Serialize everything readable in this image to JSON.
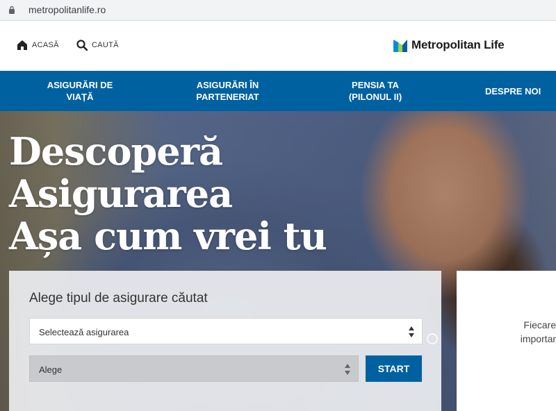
{
  "browser": {
    "url": "metropolitanlife.ro"
  },
  "utility": {
    "home_label": "ACASĂ",
    "search_label": "CAUTĂ",
    "logo_text": "Metropolitan Life",
    "logo_colors": [
      "#0090da",
      "#a4ce4e",
      "#0061a0"
    ]
  },
  "nav": {
    "items": [
      {
        "line1": "ASIGURĂRI DE",
        "line2": "VIAȚĂ"
      },
      {
        "line1": "ASIGURĂRI ÎN",
        "line2": "PARTENERIAT"
      },
      {
        "line1": "PENSIA TA",
        "line2": "(PILONUL II)"
      },
      {
        "line1": "DESPRE NOI",
        "line2": ""
      }
    ],
    "background": "#0061a0"
  },
  "hero": {
    "headline_line1": "Descoperă",
    "headline_line2": "Asigurarea",
    "headline_line3": "Așa cum vrei tu"
  },
  "selector": {
    "title": "Alege tipul de asigurare căutat",
    "insurance_select_value": "Selectează asigurarea",
    "choice_select_value": "Alege",
    "start_label": "START"
  },
  "card": {
    "line1": "Fiecare își ale",
    "line2": "importantă. Dru"
  }
}
